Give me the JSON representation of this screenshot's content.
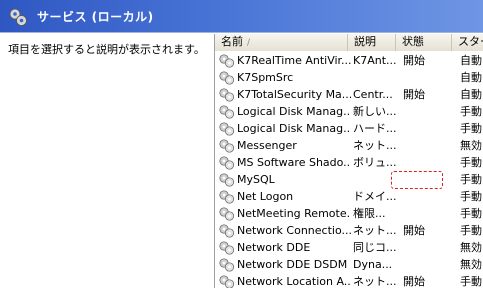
{
  "window": {
    "title": "サービス (ローカル)"
  },
  "left_pane": {
    "description": "項目を選択すると説明が表示されます。"
  },
  "columns": [
    {
      "label": "名前",
      "sort_indicator": "/"
    },
    {
      "label": "説明"
    },
    {
      "label": "状態"
    },
    {
      "label": "スター"
    }
  ],
  "services": [
    {
      "name": "K7RealTime AntiVir...",
      "description": "K7Ant...",
      "status": "開始",
      "startup": "自動"
    },
    {
      "name": "K7SpmSrc",
      "description": "",
      "status": "",
      "startup": "自動"
    },
    {
      "name": "K7TotalSecurity Ma...",
      "description": "Centr...",
      "status": "開始",
      "startup": "自動"
    },
    {
      "name": "Logical Disk Manag...",
      "description": "新しい...",
      "status": "",
      "startup": "手動"
    },
    {
      "name": "Logical Disk Manag...",
      "description": "ハード...",
      "status": "",
      "startup": "手動"
    },
    {
      "name": "Messenger",
      "description": "ネット...",
      "status": "",
      "startup": "無効"
    },
    {
      "name": "MS Software Shado...",
      "description": "ボリュ...",
      "status": "",
      "startup": "手動"
    },
    {
      "name": "MySQL",
      "description": "",
      "status": "",
      "startup": "手動"
    },
    {
      "name": "Net Logon",
      "description": "ドメイ...",
      "status": "",
      "startup": "手動"
    },
    {
      "name": "NetMeeting Remote...",
      "description": "権限...",
      "status": "",
      "startup": "手動"
    },
    {
      "name": "Network Connectio...",
      "description": "ネット...",
      "status": "開始",
      "startup": "手動"
    },
    {
      "name": "Network DDE",
      "description": "同じコ...",
      "status": "",
      "startup": "無効"
    },
    {
      "name": "Network DDE DSDM",
      "description": "Dyna...",
      "status": "",
      "startup": "無効"
    },
    {
      "name": "Network Location A...",
      "description": "ネット...",
      "status": "開始",
      "startup": "手動"
    }
  ],
  "icons": {
    "title": "gears-icon",
    "service": "gear-icon"
  },
  "colors": {
    "titlebar": "#2f57c2",
    "header": "#ece9d8",
    "focus_highlight": "#e02020"
  }
}
